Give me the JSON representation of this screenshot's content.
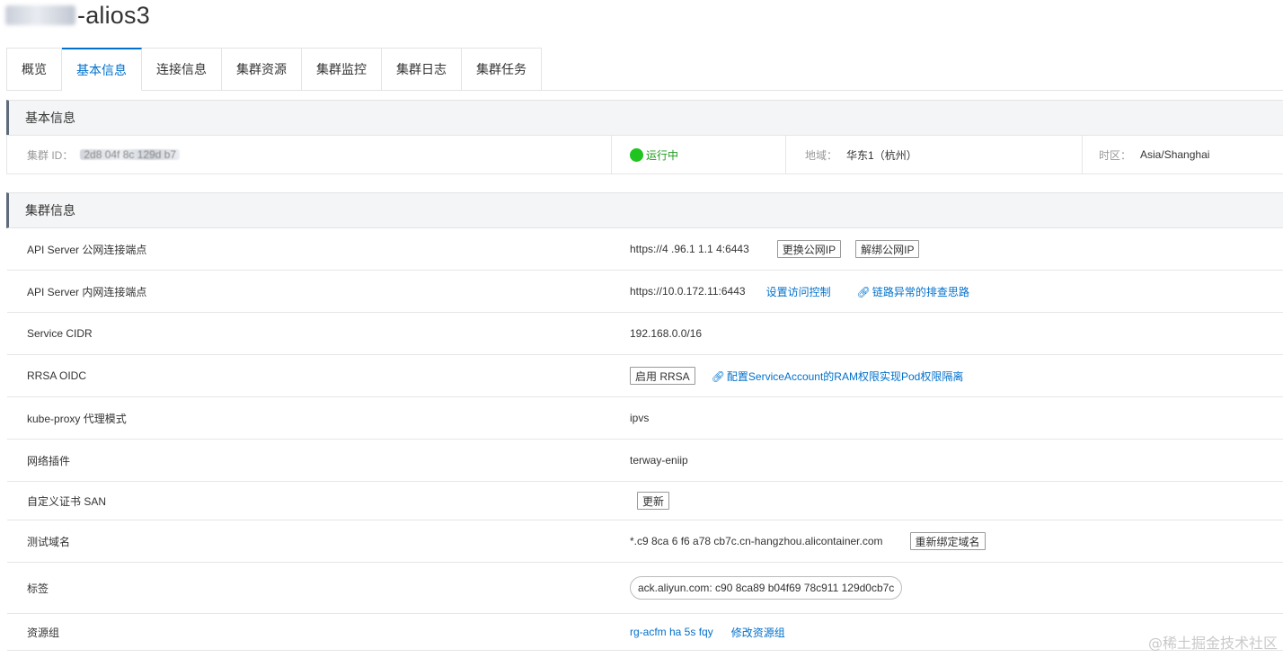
{
  "page": {
    "title_suffix": "-alios3"
  },
  "tabs": [
    {
      "label": "概览"
    },
    {
      "label": "基本信息"
    },
    {
      "label": "连接信息"
    },
    {
      "label": "集群资源"
    },
    {
      "label": "集群监控"
    },
    {
      "label": "集群日志"
    },
    {
      "label": "集群任务"
    }
  ],
  "basic_info": {
    "heading": "基本信息",
    "cluster_id_label": "集群 ID：",
    "cluster_id_visible": "2d8 04f 8c 129d b7",
    "status": "运行中",
    "region_label": "地域：",
    "region_value": "华东1（杭州）",
    "timezone_label": "时区：",
    "timezone_value": "Asia/Shanghai",
    "status_color": "#1fc41f"
  },
  "cluster_info": {
    "heading": "集群信息",
    "rows": [
      {
        "label": "API Server 公网连接端点",
        "value": "https://4 .96.1 1.1 4:6443",
        "btn1": "更换公网IP",
        "btn2": "解绑公网IP"
      },
      {
        "label": "API Server 内网连接端点",
        "value": "https://10.0.172.11:6443",
        "link1": "设置访问控制",
        "link2": "链路异常的排查思路"
      },
      {
        "label": "Service CIDR",
        "value": "192.168.0.0/16"
      },
      {
        "label": "RRSA OIDC",
        "btn1": "启用 RRSA",
        "link1": "配置ServiceAccount的RAM权限实现Pod权限隔离"
      },
      {
        "label": "kube-proxy 代理模式",
        "value": "ipvs"
      },
      {
        "label": "网络插件",
        "value": "terway-eniip"
      },
      {
        "label": "自定义证书 SAN",
        "btn1": "更新"
      },
      {
        "label": "测试域名",
        "value": "*.c9 8ca 6 f6 a78 cb7c.cn-hangzhou.alicontainer.com",
        "btn1": "重新绑定域名"
      },
      {
        "label": "标签",
        "tag": "ack.aliyun.com: c90 8ca89 b04f69 78c911 129d0cb7c"
      },
      {
        "label": "资源组",
        "link_value": "rg-acfm ha 5s fqy",
        "link1": "修改资源组"
      }
    ]
  },
  "watermark": "@稀土掘金技术社区",
  "colors": {
    "accent": "#0070cc",
    "section_bar": "#5e6a7a",
    "running": "#1e9b1e"
  }
}
